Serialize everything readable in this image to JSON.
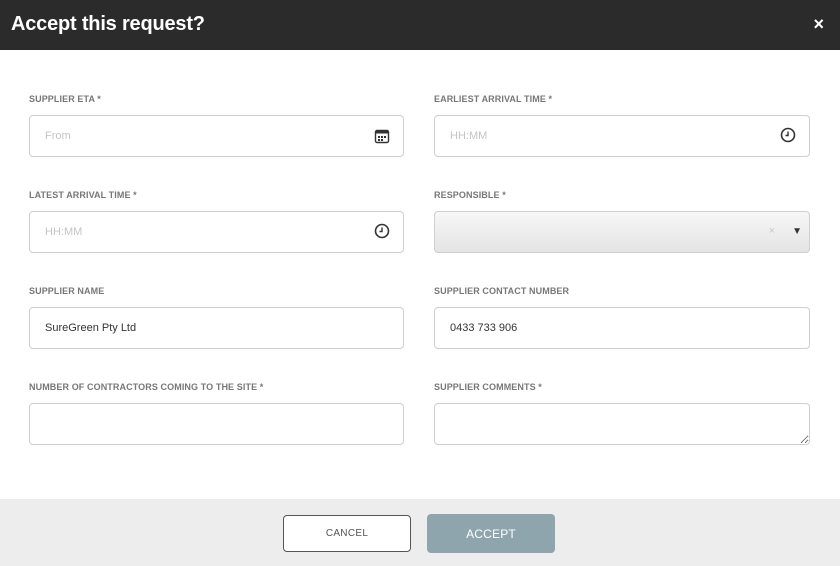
{
  "modal": {
    "title": "Accept this request?",
    "close_label": "×"
  },
  "form": {
    "supplier_eta": {
      "label": "SUPPLIER ETA *",
      "placeholder": "From",
      "value": "",
      "icon": "calendar-icon"
    },
    "earliest_arrival": {
      "label": "EARLIEST ARRIVAL TIME *",
      "placeholder": "HH:MM",
      "value": "",
      "icon": "clock-icon"
    },
    "latest_arrival": {
      "label": "LATEST ARRIVAL TIME *",
      "placeholder": "HH:MM",
      "value": "",
      "icon": "clock-icon"
    },
    "responsible": {
      "label": "RESPONSIBLE *",
      "value": "",
      "clear_label": "×",
      "caret_label": "▼"
    },
    "supplier_name": {
      "label": "SUPPLIER NAME",
      "value": "SureGreen Pty Ltd"
    },
    "supplier_contact": {
      "label": "SUPPLIER CONTACT NUMBER",
      "value": "0433 733 906"
    },
    "num_contractors": {
      "label": "NUMBER OF CONTRACTORS COMING TO THE SITE *",
      "value": ""
    },
    "supplier_comments": {
      "label": "SUPPLIER COMMENTS *",
      "value": ""
    }
  },
  "footer": {
    "cancel_label": "CANCEL",
    "accept_label": "ACCEPT"
  },
  "colors": {
    "header_bg": "#2b2b2b",
    "accept_bg": "#8fa5ad",
    "footer_bg": "#ededed"
  }
}
